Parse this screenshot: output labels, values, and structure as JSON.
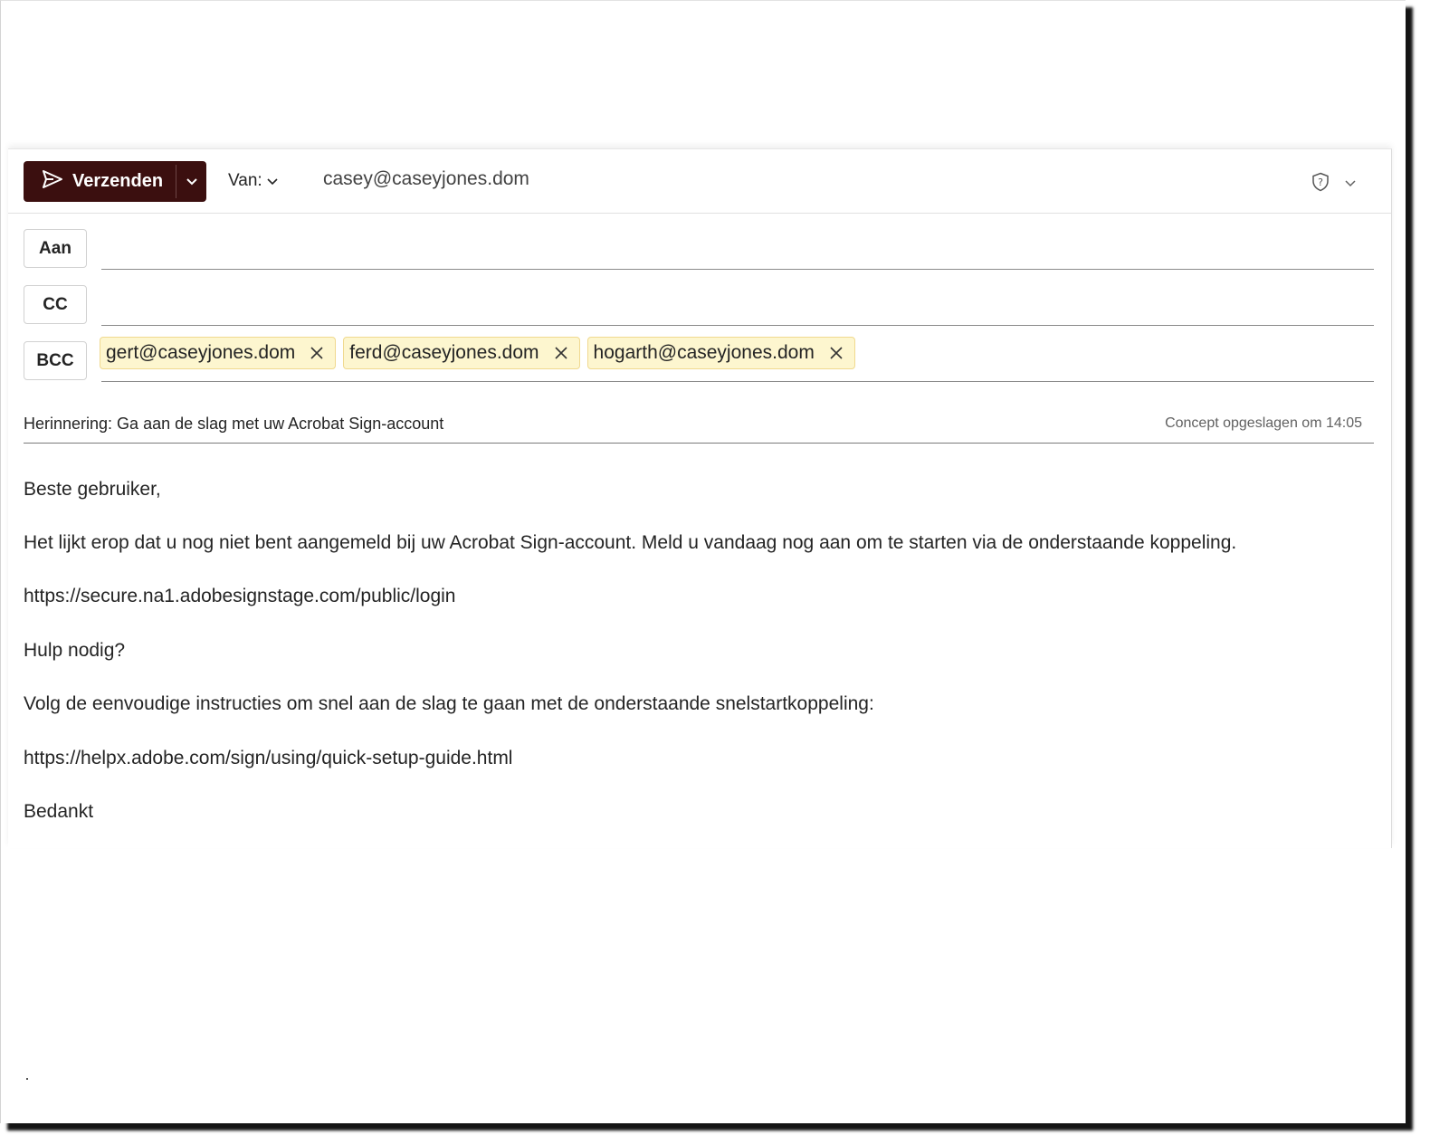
{
  "toolbar": {
    "send_label": "Verzenden",
    "from_label": "Van:",
    "from_address": "casey@caseyjones.dom"
  },
  "recipients": {
    "to_label": "Aan",
    "cc_label": "CC",
    "bcc_label": "BCC",
    "bcc": [
      "gert@caseyjones.dom",
      "ferd@caseyjones.dom",
      "hogarth@caseyjones.dom"
    ]
  },
  "subject": "Herinnering: Ga aan de slag met uw Acrobat Sign-account",
  "draft_status": "Concept opgeslagen om 14:05",
  "body": [
    "Beste gebruiker,",
    "Het lijkt erop dat u nog niet bent aangemeld bij uw Acrobat Sign-account. Meld u vandaag nog aan om te starten via de onderstaande koppeling.",
    "https://secure.na1.adobesignstage.com/public/login",
    "Hulp nodig?",
    "Volg de eenvoudige instructies om snel aan de slag te gaan met de onderstaande snelstartkoppeling:",
    "https://helpx.adobe.com/sign/using/quick-setup-guide.html",
    "Bedankt"
  ],
  "icons": {
    "send": "send-icon",
    "dropdown": "chevron-down-icon",
    "sensitivity": "shield-question-icon",
    "remove": "close-icon"
  },
  "colors": {
    "send_button": "#3b0f0f",
    "chip_bg": "#fdf6cf",
    "chip_border": "#f0d98f"
  }
}
